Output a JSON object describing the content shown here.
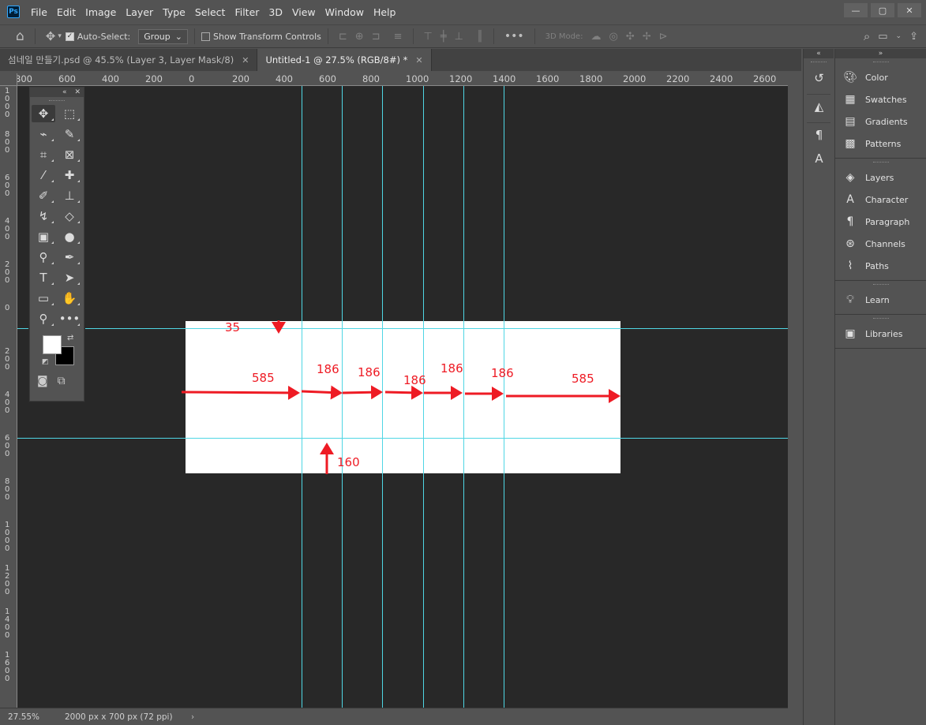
{
  "app": {
    "logo_text": "Ps"
  },
  "menu": {
    "items": [
      "File",
      "Edit",
      "Image",
      "Layer",
      "Type",
      "Select",
      "Filter",
      "3D",
      "View",
      "Window",
      "Help"
    ]
  },
  "window_controls": {
    "minimize": "—",
    "restore": "▢",
    "close": "✕"
  },
  "options": {
    "auto_select_label": "Auto-Select:",
    "auto_select_checked": true,
    "group_value": "Group",
    "show_transform_label": "Show Transform Controls",
    "show_transform_checked": false,
    "mode_3d_label": "3D Mode:"
  },
  "tabs": [
    {
      "title": "섬네일 만들기.psd @ 45.5% (Layer 3, Layer Mask/8)",
      "active": false
    },
    {
      "title": "Untitled-1 @ 27.5% (RGB/8#) *",
      "active": true
    }
  ],
  "ruler_top": [
    "800",
    "600",
    "400",
    "200",
    "0",
    "200",
    "400",
    "600",
    "800",
    "1000",
    "1200",
    "1400",
    "1600",
    "1800",
    "2000",
    "2200",
    "2400",
    "2600"
  ],
  "ruler_left": [
    "1\n0\n0\n0",
    "8\n0\n0",
    "6\n0\n0",
    "4\n0\n0",
    "2\n0\n0",
    "0",
    "2\n0\n0",
    "4\n0\n0",
    "6\n0\n0",
    "8\n0\n0",
    "1\n0\n0\n0",
    "1\n2\n0\n0",
    "1\n4\n0\n0",
    "1\n6\n0\n0"
  ],
  "annotations": {
    "top_margin": "35",
    "bottom_margin": "160",
    "left_margin": "585",
    "right_margin": "585",
    "columns": [
      "186",
      "186",
      "186",
      "186",
      "186"
    ]
  },
  "colors": {
    "foreground": "#ffffff",
    "background": "#000000",
    "guide": "#4fd6e4",
    "annotation": "#ee1b24"
  },
  "status": {
    "zoom": "27.55%",
    "doc_size": "2000 px x 700 px (72 ppi)"
  },
  "panels": {
    "group1": [
      "Color",
      "Swatches",
      "Gradients",
      "Patterns"
    ],
    "group2": [
      "Layers",
      "Character",
      "Paragraph",
      "Channels",
      "Paths"
    ],
    "group3": [
      "Learn"
    ],
    "group4": [
      "Libraries"
    ]
  }
}
